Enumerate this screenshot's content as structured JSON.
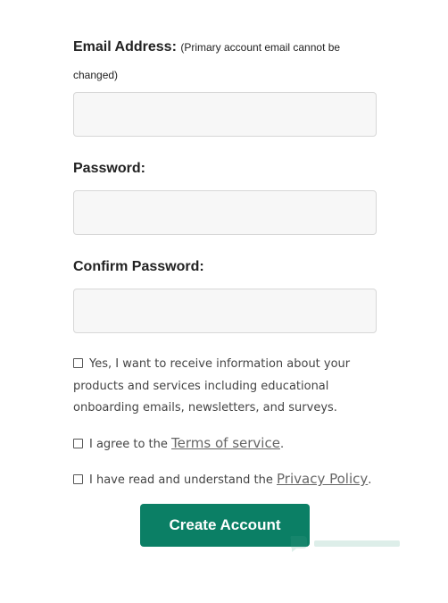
{
  "form": {
    "email": {
      "label": "Email Address:",
      "note": "(Primary account email cannot be changed)",
      "value": "",
      "placeholder": ""
    },
    "password": {
      "label": "Password:",
      "value": "",
      "placeholder": ""
    },
    "confirm_password": {
      "label": "Confirm Password:",
      "value": "",
      "placeholder": ""
    },
    "marketing_consent": {
      "text": "Yes, I want to receive information about your products and services including educational onboarding emails, newsletters, and surveys.",
      "checked": false
    },
    "terms": {
      "prefix": "I agree to the",
      "link": "Terms of service",
      "suffix": ".",
      "checked": false
    },
    "privacy": {
      "prefix": "I have read and understand the",
      "link": "Privacy Policy",
      "suffix": ".",
      "checked": false
    },
    "submit_label": "Create Account"
  },
  "colors": {
    "primary_button": "#0b7f65",
    "input_background": "#f7f7f7",
    "input_border": "#d7d7d7"
  },
  "icons": {
    "watermark": "brand-watermark-icon"
  }
}
